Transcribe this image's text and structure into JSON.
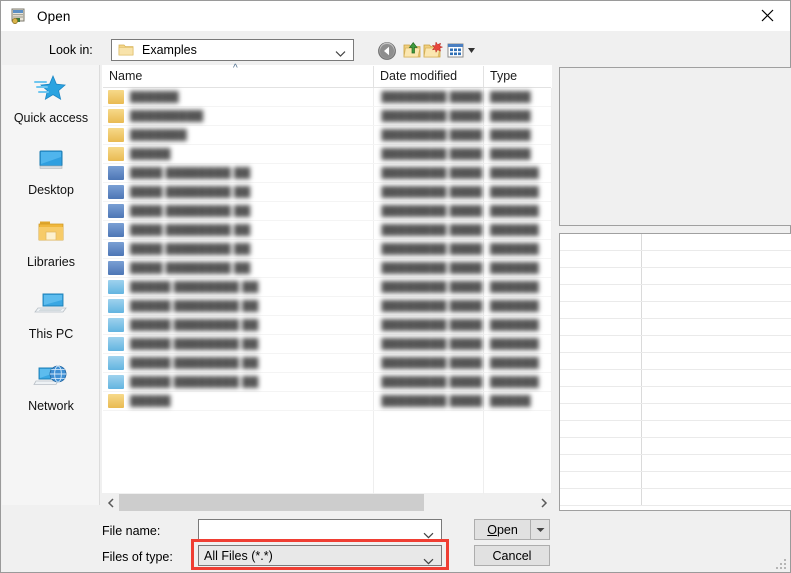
{
  "window": {
    "title": "Open",
    "title_icon": "open-file-dialog-icon",
    "close_icon": "close-icon"
  },
  "lookin": {
    "label": "Look in:",
    "value": "Examples",
    "folder_icon": "folder-icon",
    "dropdown_icon": "chevron-down-icon"
  },
  "toolbar": {
    "back": "back-arrow-icon",
    "up": "up-one-level-icon",
    "new_folder": "new-folder-icon",
    "views": "views-icon",
    "views_arrow": "chevron-down-icon"
  },
  "places": {
    "items": [
      {
        "label": "Quick access",
        "icon": "quick-access-star-icon"
      },
      {
        "label": "Desktop",
        "icon": "desktop-monitor-icon"
      },
      {
        "label": "Libraries",
        "icon": "libraries-folder-icon"
      },
      {
        "label": "This PC",
        "icon": "this-pc-computer-icon"
      },
      {
        "label": "Network",
        "icon": "network-globe-icon"
      }
    ]
  },
  "filelist": {
    "columns": [
      "Name",
      "Date modified",
      "Type"
    ],
    "sort_indicator": "sort-ascending-caret",
    "rows": [
      {
        "icon": "folder-icon",
        "name": "██████",
        "date": "████████ ████ ██",
        "type": "█████"
      },
      {
        "icon": "folder-icon",
        "name": "█████████",
        "date": "████████ ████ ██",
        "type": "█████"
      },
      {
        "icon": "folder-icon",
        "name": "███████",
        "date": "████████ ████ ██",
        "type": "█████"
      },
      {
        "icon": "folder-icon",
        "name": "█████",
        "date": "████████ ████ ██",
        "type": "█████"
      },
      {
        "icon": "document-blue-icon",
        "name": "████ ████████ ██",
        "date": "████████ ████ ██",
        "type": "██████"
      },
      {
        "icon": "document-blue-icon",
        "name": "████ ████████ ██",
        "date": "████████ ████ ██",
        "type": "██████"
      },
      {
        "icon": "document-blue-icon",
        "name": "████ ████████ ██",
        "date": "████████ ████ ██",
        "type": "██████"
      },
      {
        "icon": "document-blue-icon",
        "name": "████ ████████ ██",
        "date": "████████ ████ ██",
        "type": "██████"
      },
      {
        "icon": "document-blue-icon",
        "name": "████ ████████ ██",
        "date": "████████ ████ ██",
        "type": "██████"
      },
      {
        "icon": "document-blue-icon",
        "name": "████ ████████ ██",
        "date": "████████ ████ ██",
        "type": "██████"
      },
      {
        "icon": "document-cyan-icon",
        "name": "█████ ████████ ██",
        "date": "████████ ████ ██",
        "type": "██████"
      },
      {
        "icon": "document-cyan-icon",
        "name": "█████ ████████ ██",
        "date": "████████ ████ ██",
        "type": "██████"
      },
      {
        "icon": "document-cyan-icon",
        "name": "█████ ████████ ██",
        "date": "████████ ████ ██",
        "type": "██████"
      },
      {
        "icon": "document-cyan-icon",
        "name": "█████ ████████ ██",
        "date": "████████ ████ ██",
        "type": "██████"
      },
      {
        "icon": "document-cyan-icon",
        "name": "█████ ████████ ██",
        "date": "████████ ████ ██",
        "type": "██████"
      },
      {
        "icon": "document-cyan-icon",
        "name": "█████ ████████ ██",
        "date": "████████ ████ ██",
        "type": "██████"
      },
      {
        "icon": "folder-icon",
        "name": "█████",
        "date": "████████ ████ ██",
        "type": "█████"
      }
    ]
  },
  "scrollbar": {
    "left_arrow": "chevron-left-icon",
    "right_arrow": "chevron-right-icon"
  },
  "right_panel": {
    "preview_empty": "",
    "property_rows": 16
  },
  "form": {
    "filename_label": "File name:",
    "filename_value": "",
    "filetype_label": "Files of type:",
    "filetype_value": "All Files (*.*)",
    "dropdown_icon": "chevron-down-icon"
  },
  "buttons": {
    "open": "Open",
    "open_accel": "O",
    "open_rest": "pen",
    "open_split_icon": "chevron-down-icon",
    "cancel": "Cancel"
  },
  "highlight": {
    "target": "files-of-type-combo",
    "color": "#ef3e33"
  },
  "grip": "resize-grip-icon"
}
